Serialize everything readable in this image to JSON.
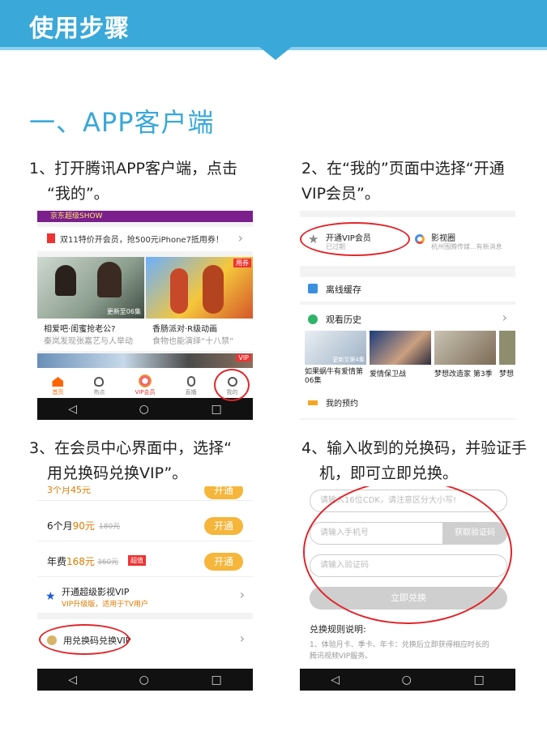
{
  "header": {
    "title": "使用步骤"
  },
  "section": {
    "title": "一、APP客户端"
  },
  "steps": [
    {
      "line1": "1、打开腾讯APP客户端，点击",
      "line2": "“我的”。"
    },
    {
      "line1": "2、在“我的”页面中选择“开通",
      "line2": "VIP会员”。"
    },
    {
      "line1": "3、在会员中心界面中，选择“",
      "line2": "用兑换码兑换VIP”。"
    },
    {
      "line1": "4、输入收到的兑换码，并验证手",
      "line2": "机，即可立即兑换。"
    }
  ],
  "panel1": {
    "top_banner": "京东超级SHOW",
    "promo": "双11特价开会员，抢500元iPhone7抵用券！",
    "promo_arrow": "›",
    "card1_badge": "更新至06集",
    "card1_title": "相爱吧·闺蜜抢老公?",
    "card1_sub": "秦岚发现张嘉艺与人举动",
    "card2_title": "香肠派对·R级动画",
    "card2_sub": "食物也能演绎“十八禁”",
    "card2_tag": "用券",
    "vip_tag": "VIP",
    "tabs": [
      "首页",
      "热点",
      "VIP会员",
      "直播",
      "我的"
    ]
  },
  "panel2": {
    "open_vip": "开通VIP会员",
    "open_vip_sub": "已过期",
    "yingshi": "影视圈",
    "yingshi_sub": "杭州围腾传媒...有新消息",
    "offline": "离线缓存",
    "history": "观看历史",
    "history_arrow": "›",
    "thumb_badge": "更新至第4集",
    "shows": [
      "如果蜗牛有爱情第06集",
      "爱情保卫战",
      "梦想改造家 第3季",
      "梦想"
    ],
    "bottom": "我的预约"
  },
  "panel3": {
    "cut_row": "3个月45元",
    "rows": [
      {
        "label": "6个月",
        "price": "90元",
        "orig": "180元",
        "btn": "开通"
      },
      {
        "label": "年费",
        "price": "168元",
        "orig": "360元",
        "badge": "超值",
        "btn": "开通"
      }
    ],
    "super_title": "开通超级影视VIP",
    "super_sub": "VIP升级版，适用于TV用户",
    "redeem": "用兑换码兑换VIP",
    "arrow": "›"
  },
  "panel4": {
    "cdk_placeholder": "请输入16位CDK，请注意区分大小写!",
    "phone_placeholder": "请输入手机号",
    "get_code": "获取验证码",
    "code_placeholder": "请输入验证码",
    "submit": "立即兑换",
    "rules_title": "兑换规则说明:",
    "rules_1": "1、体验月卡、季卡、年卡：兑换后立即获得相应时长的",
    "rules_2": "腾讯视频VIP服务。"
  },
  "nav": {
    "back": "◁",
    "home": "○",
    "recent": "□"
  },
  "colors": {
    "accent": "#3aa8d8",
    "highlight": "#e0262b",
    "vip_orange": "#f5b63b"
  }
}
